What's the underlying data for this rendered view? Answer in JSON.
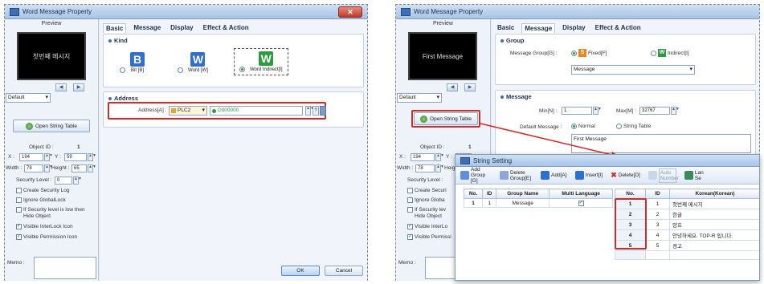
{
  "left_window": {
    "title": "Word Message Property",
    "close_label": "✕",
    "preview_label": "Preview",
    "preview_text": "첫번째 메시지",
    "state_value": "Default",
    "open_string_table_label": "Open String Table",
    "object_id_label": "Object ID :",
    "object_id_value": "1",
    "x_label": "X :",
    "x_value": "194",
    "y_label": "Y :",
    "y_value": "59",
    "width_label": "Width :",
    "width_value": "78",
    "height_label": "Height :",
    "height_value": "65",
    "security_label": "Security Level :",
    "security_value": "0",
    "checks": [
      {
        "label": "Create Security Log",
        "checked": false
      },
      {
        "label": "Ignore GlobalLock",
        "checked": false
      },
      {
        "label": "If Security level is low then Hide Object",
        "checked": false
      },
      {
        "label": "Visible InterLock Icon",
        "checked": true
      },
      {
        "label": "Visible Permission Icon",
        "checked": true
      }
    ],
    "memo_label": "Memo :",
    "tabs": [
      "Basic",
      "Message",
      "Display",
      "Effect & Action"
    ],
    "kind_title": "Kind",
    "kind_options": [
      {
        "icon": "B",
        "label": "Bit [B]",
        "color": "#2f6fd0"
      },
      {
        "icon": "W",
        "label": "Word [W]",
        "color": "#2f6fd0"
      },
      {
        "icon": "W",
        "label": "Word Indirect[I]",
        "color": "#2c9a3f"
      }
    ],
    "address_title": "Address",
    "address_label": "Address[A] :",
    "address_device": "PLC2",
    "address_value": "D000000",
    "ok_label": "OK",
    "cancel_label": "Cancel"
  },
  "right_window": {
    "title": "Word Message Property",
    "preview_label": "Preview",
    "preview_text": "First Message",
    "state_value": "Default",
    "open_string_table_label": "Open String Table",
    "object_id_label": "Object ID :",
    "object_id_value": "1",
    "x_label": "X :",
    "x_value": "194",
    "y_label": "Y :",
    "y_value": "59",
    "width_label": "Width :",
    "width_value": "78",
    "height_partial": "Heig",
    "security_partial": "Security Level :",
    "partial_checks": [
      "Create Securi",
      "Ignore Globa",
      "If Security lev Hide Object",
      "Visible InterLo",
      "Visible Permissi"
    ],
    "memo_label": "Memo :",
    "tabs": [
      "Basic",
      "Message",
      "Display",
      "Effect & Action"
    ],
    "group_title": "Group",
    "message_group_label": "Message Group[G] :",
    "fixed_label": "Fixed[F]",
    "indirect_label": "Indirect[I]",
    "group_value": "Message",
    "message_title": "Message",
    "min_label": "Min[N] :",
    "min_value": "1",
    "max_label": "Max[M] :",
    "max_value": "32767",
    "default_message_label": "Default Message :",
    "normal_label": "Normal",
    "string_table_label": "String Table",
    "default_message_value": "First Message"
  },
  "string_setting": {
    "title": "String Setting",
    "toolbar": [
      "Add Group [G]",
      "Delete Group[E]",
      "Add[A]",
      "Insert[I]",
      "Delete[D]",
      "Auto Number",
      "Lan Se"
    ],
    "group_columns": [
      "No.",
      "ID",
      "Group Name",
      "Multi Language"
    ],
    "group_rows": [
      {
        "no": "1",
        "id": "1",
        "name": "Message",
        "multi": "✓"
      }
    ],
    "string_columns": [
      "No.",
      "ID",
      "Korean(Korean)"
    ],
    "string_rows": [
      {
        "no": "1",
        "id": "1",
        "text": "첫번째 메시지"
      },
      {
        "no": "2",
        "id": "2",
        "text": "한글"
      },
      {
        "no": "3",
        "id": "3",
        "text": "양호"
      },
      {
        "no": "4",
        "id": "4",
        "text": "안녕하세요. TOP-R 입니다."
      },
      {
        "no": "5",
        "id": "5",
        "text": "경고"
      }
    ]
  },
  "colors": {
    "accent": "#3d6fb6",
    "highlight_red": "#d42a2a",
    "green": "#2c9a3f"
  }
}
